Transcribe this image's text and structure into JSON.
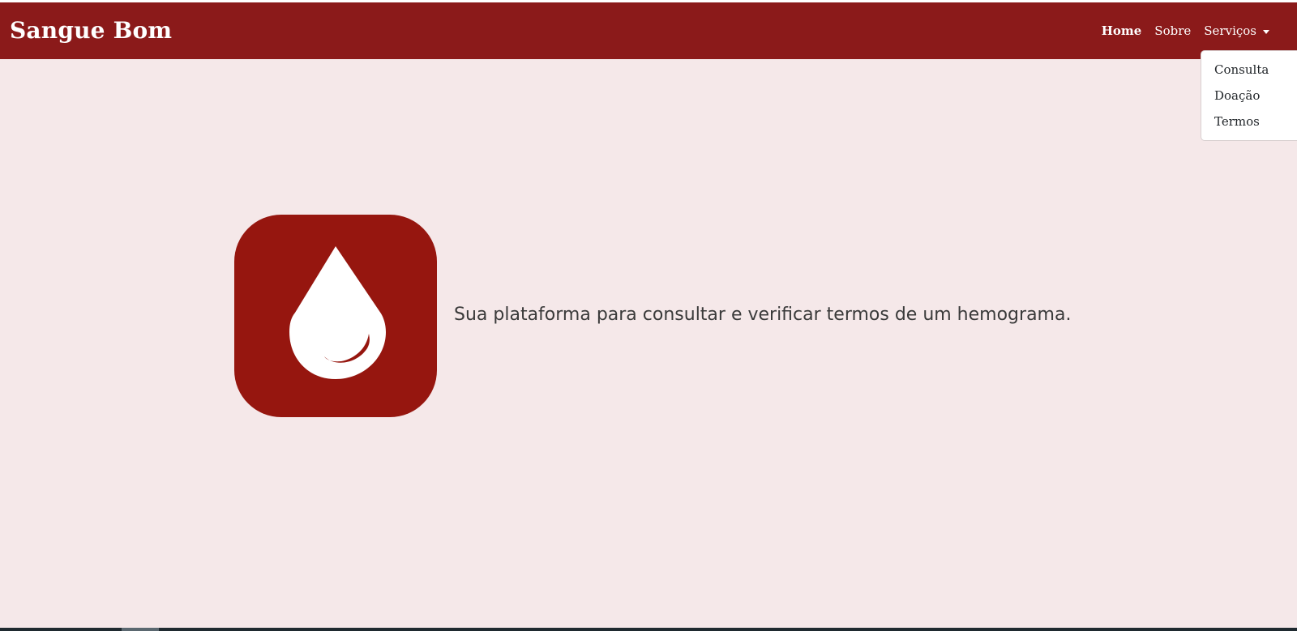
{
  "navbar": {
    "brand": "Sangue Bom",
    "links": {
      "home": "Home",
      "sobre": "Sobre",
      "servicos": "Serviços"
    }
  },
  "dropdown": {
    "items": [
      "Consulta",
      "Doação",
      "Termos"
    ]
  },
  "hero": {
    "logo_icon": "blood-drop-icon",
    "tagline": "Sua plataforma para consultar e verificar termos de um hemograma."
  },
  "colors": {
    "navbar": "#8b1a1a",
    "logo_background": "#96160f",
    "page_background": "#f5e8e9",
    "navbar_text": "#ffffff",
    "tagline_text": "#3a3a3a"
  }
}
